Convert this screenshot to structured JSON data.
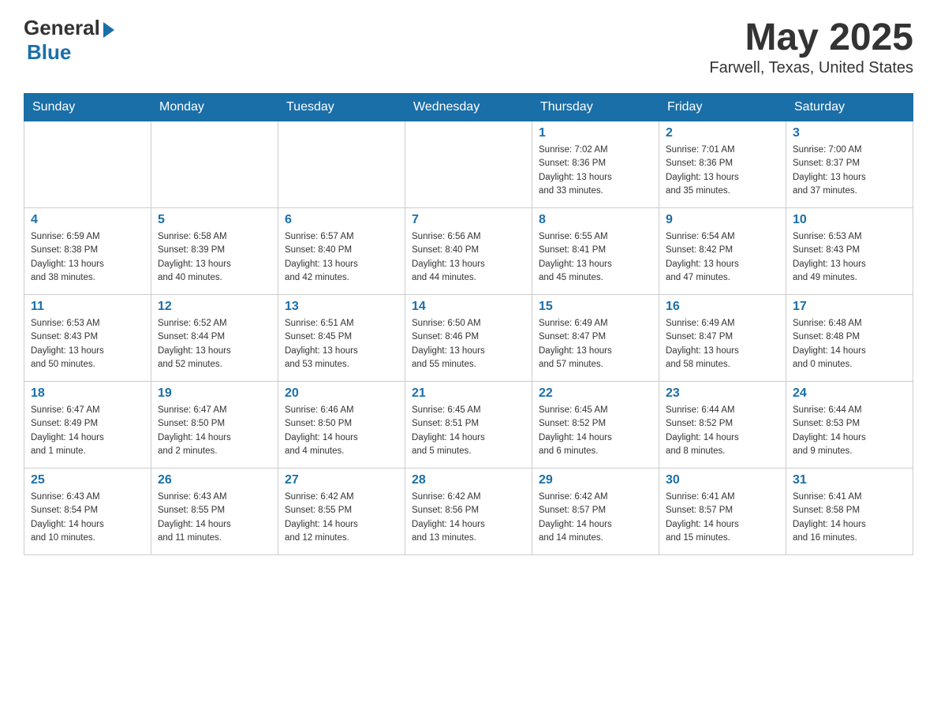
{
  "header": {
    "logo_general": "General",
    "logo_blue": "Blue",
    "month_year": "May 2025",
    "location": "Farwell, Texas, United States"
  },
  "days_of_week": [
    "Sunday",
    "Monday",
    "Tuesday",
    "Wednesday",
    "Thursday",
    "Friday",
    "Saturday"
  ],
  "weeks": [
    [
      {
        "day": "",
        "info": ""
      },
      {
        "day": "",
        "info": ""
      },
      {
        "day": "",
        "info": ""
      },
      {
        "day": "",
        "info": ""
      },
      {
        "day": "1",
        "info": "Sunrise: 7:02 AM\nSunset: 8:36 PM\nDaylight: 13 hours\nand 33 minutes."
      },
      {
        "day": "2",
        "info": "Sunrise: 7:01 AM\nSunset: 8:36 PM\nDaylight: 13 hours\nand 35 minutes."
      },
      {
        "day": "3",
        "info": "Sunrise: 7:00 AM\nSunset: 8:37 PM\nDaylight: 13 hours\nand 37 minutes."
      }
    ],
    [
      {
        "day": "4",
        "info": "Sunrise: 6:59 AM\nSunset: 8:38 PM\nDaylight: 13 hours\nand 38 minutes."
      },
      {
        "day": "5",
        "info": "Sunrise: 6:58 AM\nSunset: 8:39 PM\nDaylight: 13 hours\nand 40 minutes."
      },
      {
        "day": "6",
        "info": "Sunrise: 6:57 AM\nSunset: 8:40 PM\nDaylight: 13 hours\nand 42 minutes."
      },
      {
        "day": "7",
        "info": "Sunrise: 6:56 AM\nSunset: 8:40 PM\nDaylight: 13 hours\nand 44 minutes."
      },
      {
        "day": "8",
        "info": "Sunrise: 6:55 AM\nSunset: 8:41 PM\nDaylight: 13 hours\nand 45 minutes."
      },
      {
        "day": "9",
        "info": "Sunrise: 6:54 AM\nSunset: 8:42 PM\nDaylight: 13 hours\nand 47 minutes."
      },
      {
        "day": "10",
        "info": "Sunrise: 6:53 AM\nSunset: 8:43 PM\nDaylight: 13 hours\nand 49 minutes."
      }
    ],
    [
      {
        "day": "11",
        "info": "Sunrise: 6:53 AM\nSunset: 8:43 PM\nDaylight: 13 hours\nand 50 minutes."
      },
      {
        "day": "12",
        "info": "Sunrise: 6:52 AM\nSunset: 8:44 PM\nDaylight: 13 hours\nand 52 minutes."
      },
      {
        "day": "13",
        "info": "Sunrise: 6:51 AM\nSunset: 8:45 PM\nDaylight: 13 hours\nand 53 minutes."
      },
      {
        "day": "14",
        "info": "Sunrise: 6:50 AM\nSunset: 8:46 PM\nDaylight: 13 hours\nand 55 minutes."
      },
      {
        "day": "15",
        "info": "Sunrise: 6:49 AM\nSunset: 8:47 PM\nDaylight: 13 hours\nand 57 minutes."
      },
      {
        "day": "16",
        "info": "Sunrise: 6:49 AM\nSunset: 8:47 PM\nDaylight: 13 hours\nand 58 minutes."
      },
      {
        "day": "17",
        "info": "Sunrise: 6:48 AM\nSunset: 8:48 PM\nDaylight: 14 hours\nand 0 minutes."
      }
    ],
    [
      {
        "day": "18",
        "info": "Sunrise: 6:47 AM\nSunset: 8:49 PM\nDaylight: 14 hours\nand 1 minute."
      },
      {
        "day": "19",
        "info": "Sunrise: 6:47 AM\nSunset: 8:50 PM\nDaylight: 14 hours\nand 2 minutes."
      },
      {
        "day": "20",
        "info": "Sunrise: 6:46 AM\nSunset: 8:50 PM\nDaylight: 14 hours\nand 4 minutes."
      },
      {
        "day": "21",
        "info": "Sunrise: 6:45 AM\nSunset: 8:51 PM\nDaylight: 14 hours\nand 5 minutes."
      },
      {
        "day": "22",
        "info": "Sunrise: 6:45 AM\nSunset: 8:52 PM\nDaylight: 14 hours\nand 6 minutes."
      },
      {
        "day": "23",
        "info": "Sunrise: 6:44 AM\nSunset: 8:52 PM\nDaylight: 14 hours\nand 8 minutes."
      },
      {
        "day": "24",
        "info": "Sunrise: 6:44 AM\nSunset: 8:53 PM\nDaylight: 14 hours\nand 9 minutes."
      }
    ],
    [
      {
        "day": "25",
        "info": "Sunrise: 6:43 AM\nSunset: 8:54 PM\nDaylight: 14 hours\nand 10 minutes."
      },
      {
        "day": "26",
        "info": "Sunrise: 6:43 AM\nSunset: 8:55 PM\nDaylight: 14 hours\nand 11 minutes."
      },
      {
        "day": "27",
        "info": "Sunrise: 6:42 AM\nSunset: 8:55 PM\nDaylight: 14 hours\nand 12 minutes."
      },
      {
        "day": "28",
        "info": "Sunrise: 6:42 AM\nSunset: 8:56 PM\nDaylight: 14 hours\nand 13 minutes."
      },
      {
        "day": "29",
        "info": "Sunrise: 6:42 AM\nSunset: 8:57 PM\nDaylight: 14 hours\nand 14 minutes."
      },
      {
        "day": "30",
        "info": "Sunrise: 6:41 AM\nSunset: 8:57 PM\nDaylight: 14 hours\nand 15 minutes."
      },
      {
        "day": "31",
        "info": "Sunrise: 6:41 AM\nSunset: 8:58 PM\nDaylight: 14 hours\nand 16 minutes."
      }
    ]
  ]
}
